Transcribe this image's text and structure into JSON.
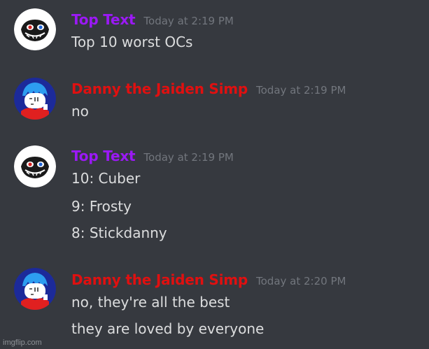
{
  "theme": {
    "background": "#36393f",
    "message_text_color": "#dcddde",
    "timestamp_color": "#72767d"
  },
  "messages": [
    {
      "username": "Top Text",
      "username_color": "#9b19f5",
      "avatar_icon": "troll-face-avatar-icon",
      "timestamp": "Today at 2:19 PM",
      "lines": [
        "Top 10 worst OCs"
      ]
    },
    {
      "username": "Danny the Jaiden Simp",
      "username_color": "#e01010",
      "avatar_icon": "blue-haired-character-avatar-icon",
      "timestamp": "Today at 2:19 PM",
      "lines": [
        "no"
      ]
    },
    {
      "username": "Top Text",
      "username_color": "#9b19f5",
      "avatar_icon": "troll-face-avatar-icon",
      "timestamp": "Today at 2:19 PM",
      "lines": [
        "10: Cuber",
        "9: Frosty",
        "8: Stickdanny"
      ]
    },
    {
      "username": "Danny the Jaiden Simp",
      "username_color": "#e01010",
      "avatar_icon": "blue-haired-character-avatar-icon",
      "timestamp": "Today at 2:20 PM",
      "lines": [
        "no, they're all the best",
        "they are loved by everyone"
      ]
    }
  ],
  "watermark": "imgflip.com"
}
